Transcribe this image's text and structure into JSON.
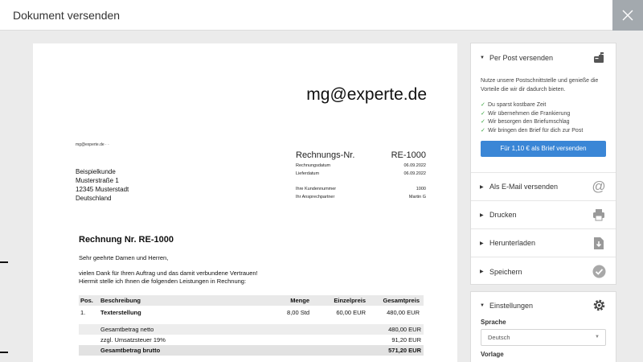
{
  "window": {
    "title": "Dokument versenden"
  },
  "document": {
    "sender_big": "mg@experte.de",
    "sender_small": "mg@experte.de · ·",
    "recipient": [
      "Beispielkunde",
      "Musterstraße 1",
      "12345 Musterstadt",
      "Deutschland"
    ],
    "invoice_no_label": "Rechnungs-Nr.",
    "invoice_no": "RE-1000",
    "meta_dates": [
      {
        "label": "Rechnungsdatum",
        "value": "06.09.2022"
      },
      {
        "label": "Lieferdatum",
        "value": "06.09.2022"
      }
    ],
    "meta_contact": [
      {
        "label": "Ihre Kundennummer",
        "value": "1000"
      },
      {
        "label": "Ihr Ansprechpartner",
        "value": "Martin G"
      }
    ],
    "invoice_title": "Rechnung Nr. RE-1000",
    "salutation": "Sehr geehrte Damen und Herren,",
    "body_lines": [
      "vielen Dank für Ihren Auftrag und das damit verbundene Vertrauen!",
      "Hiermit stelle ich Ihnen die folgenden Leistungen in Rechnung:"
    ],
    "table": {
      "headers": [
        "Pos.",
        "Beschreibung",
        "Menge",
        "Einzelpreis",
        "Gesamtpreis"
      ],
      "rows": [
        [
          "1.",
          "Texterstellung",
          "8,00 Std",
          "60,00 EUR",
          "480,00 EUR"
        ]
      ],
      "totals": [
        {
          "label": "Gesamtbetrag netto",
          "value": "480,00 EUR"
        },
        {
          "label": "zzgl. Umsatzsteuer 19%",
          "value": "91,20 EUR"
        },
        {
          "label": "Gesamtbetrag brutto",
          "value": "571,20 EUR"
        }
      ]
    }
  },
  "sidebar": {
    "post": {
      "title": "Per Post versenden",
      "intro": "Nutze unsere Postschnittstelle und genieße die Vorteile die wir dir dadurch bieten.",
      "benefits": [
        "Du sparst kostbare Zeit",
        "Wir übernehmen die Frankierung",
        "Wir besorgen den Briefumschlag",
        "Wir bringen den Brief für dich zur Post"
      ],
      "button": "Für 1,10 € als Brief versenden"
    },
    "email": "Als E-Mail versenden",
    "print": "Drucken",
    "download": "Herunterladen",
    "save": "Speichern",
    "settings": {
      "title": "Einstellungen",
      "language_label": "Sprache",
      "language_value": "Deutsch",
      "template_label": "Vorlage"
    }
  },
  "colors": {
    "accent": "#3a86d6",
    "check": "#3aa641",
    "close_bg": "#a3a9ae"
  }
}
